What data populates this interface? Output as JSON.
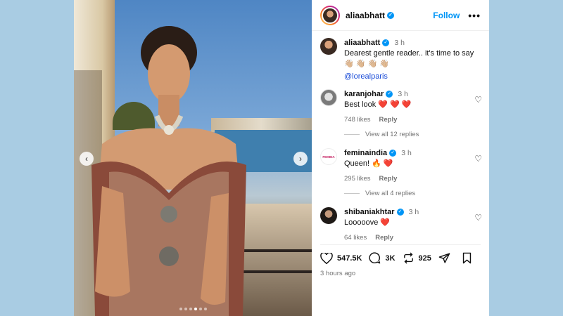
{
  "colors": {
    "background": "#a9cce3",
    "accent": "#0095f6",
    "like": "#e11d48"
  },
  "carousel": {
    "slide_count": 6,
    "active_index": 3
  },
  "post": {
    "author": "aliaabhatt",
    "follow_label": "Follow",
    "more_label": "•••",
    "caption": {
      "user": "aliaabhatt",
      "time": "3 h",
      "text": "Dearest gentle reader.. it's time to say 👋🏼 👋🏼 👋🏼 👋🏼",
      "mention": "@lorealparis"
    }
  },
  "comments": [
    {
      "user": "karanjohar",
      "time": "3 h",
      "text": "Best look ❤️ ❤️ ❤️",
      "likes": "748 likes",
      "reply": "Reply",
      "avatar_icon": "karanjohar-avatar"
    },
    {
      "user": "feminaindia",
      "time": "3 h",
      "text": "Queen! 🔥 ❤️",
      "likes": "295 likes",
      "reply": "Reply",
      "avatar_icon": "feminaindia-avatar",
      "avatar_text": "FEMINA"
    },
    {
      "user": "shibaniakhtar",
      "time": "3 h",
      "text": "Looooove ❤️",
      "likes": "64 likes",
      "reply": "Reply",
      "avatar_icon": "shibaniakhtar-avatar"
    }
  ],
  "view_replies": [
    "View all 12 replies",
    "View all 4 replies"
  ],
  "actions": {
    "likes": "547.5K",
    "comments": "3K",
    "reposts": "925"
  },
  "timestamp": "3 hours ago"
}
